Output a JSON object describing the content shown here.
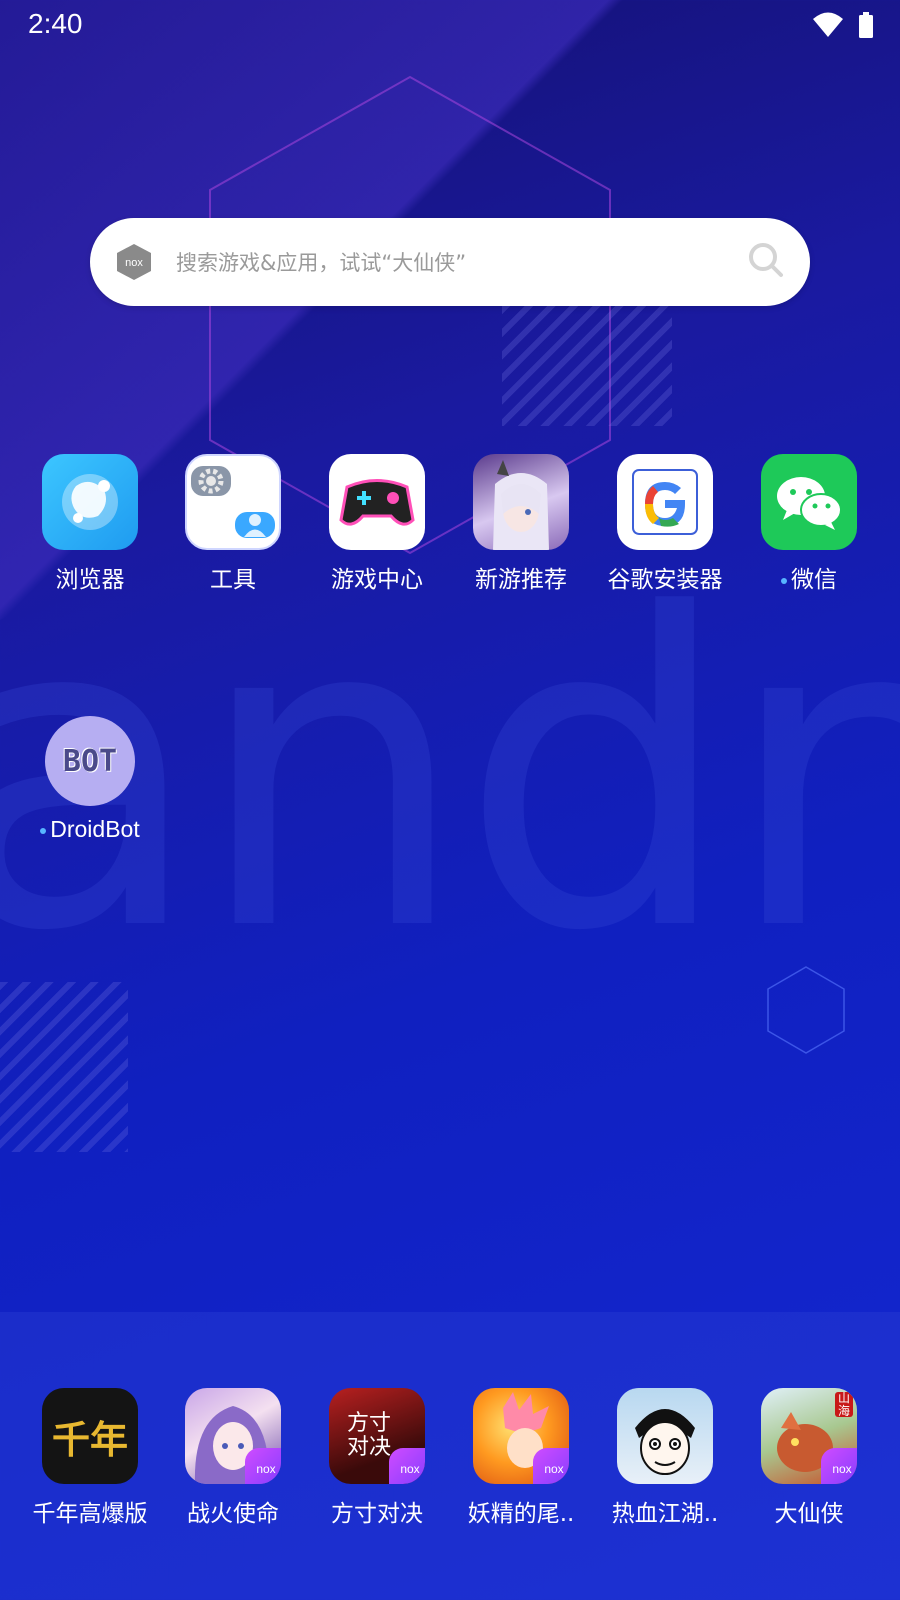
{
  "status_bar": {
    "time": "2:40",
    "wifi_icon": "wifi-icon",
    "battery_icon": "battery-icon"
  },
  "search": {
    "logo_text": "nox",
    "placeholder": "搜索游戏&应用，试试“大仙侠”",
    "icon": "search-icon"
  },
  "background": {
    "watermark": "andro"
  },
  "apps": [
    {
      "label": "浏览器",
      "icon": "browser-icon"
    },
    {
      "label": "工具",
      "icon": "tools-folder-icon"
    },
    {
      "label": "游戏中心",
      "icon": "game-center-icon"
    },
    {
      "label": "新游推荐",
      "icon": "new-games-icon"
    },
    {
      "label": "谷歌安装器",
      "icon": "google-installer-icon"
    },
    {
      "label": "微信",
      "icon": "wechat-icon",
      "new": true
    }
  ],
  "droidbot": {
    "label": "DroidBot",
    "icon_text": "BOT",
    "new": true
  },
  "dock": [
    {
      "label": "千年高爆版",
      "icon": "qiannian-icon",
      "icon_text": "千年"
    },
    {
      "label": "战火使命",
      "icon": "zhanhuo-icon"
    },
    {
      "label": "方寸对决",
      "icon": "fangcun-icon",
      "icon_text": "方寸对决"
    },
    {
      "label": "妖精的尾..",
      "icon": "fairy-tail-icon"
    },
    {
      "label": "热血江湖..",
      "icon": "rexue-icon"
    },
    {
      "label": "大仙侠",
      "icon": "daxianxia-icon",
      "icon_text": "山海"
    }
  ],
  "colors": {
    "accent": "#1a1aa0",
    "dot": "#58b5ff",
    "wechat": "#1ec959",
    "browser": "#2bb3f7"
  }
}
